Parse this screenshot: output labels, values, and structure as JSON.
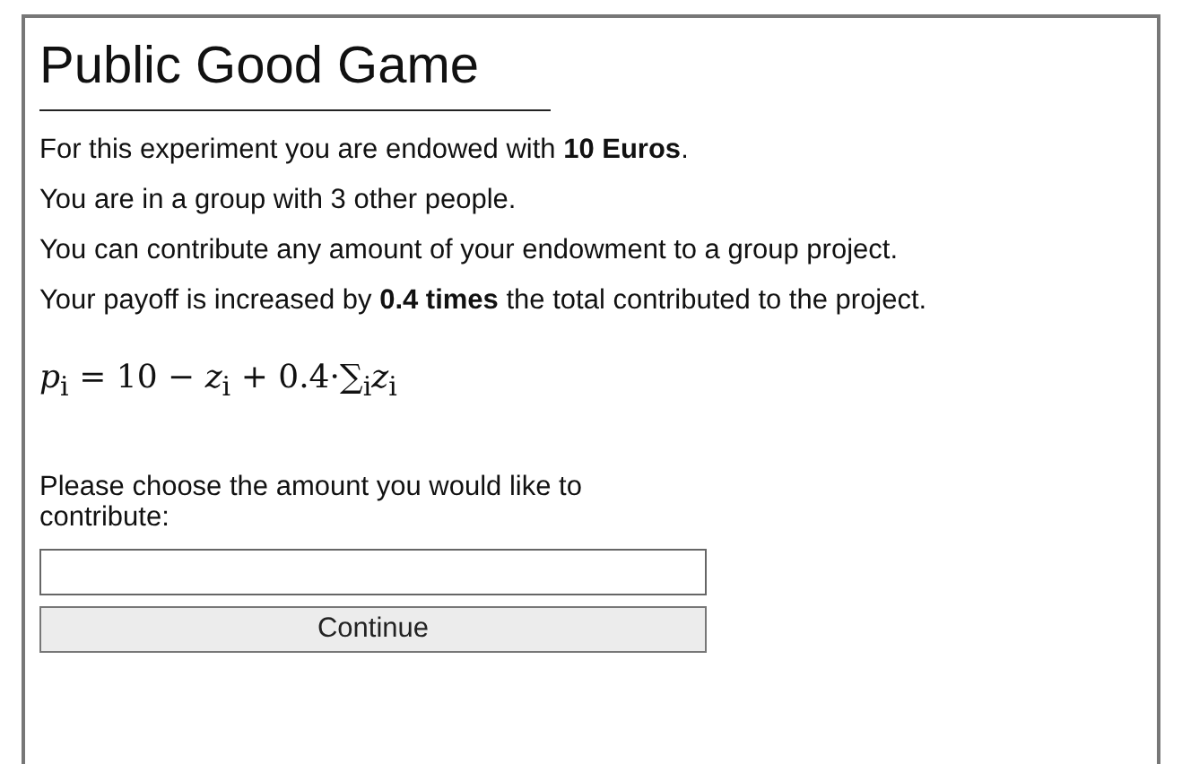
{
  "title": "Public Good Game",
  "paragraphs": [
    "For this experiment you are endowed with **10 Euros**.",
    "You are in a group with 3 other people.",
    "You can contribute any amount of your endowment to a group project.",
    "Your payoff is increased by **0.4 times** the total contributed to the project."
  ],
  "formula": "*p*$_{i}$ = 10 − *z*$_{i}$ + 0.4·∑$_{i}$*z*$_{i}$",
  "prompt": "Please choose the amount you would like to contribute:",
  "buttons": [
    "Continue"
  ]
}
